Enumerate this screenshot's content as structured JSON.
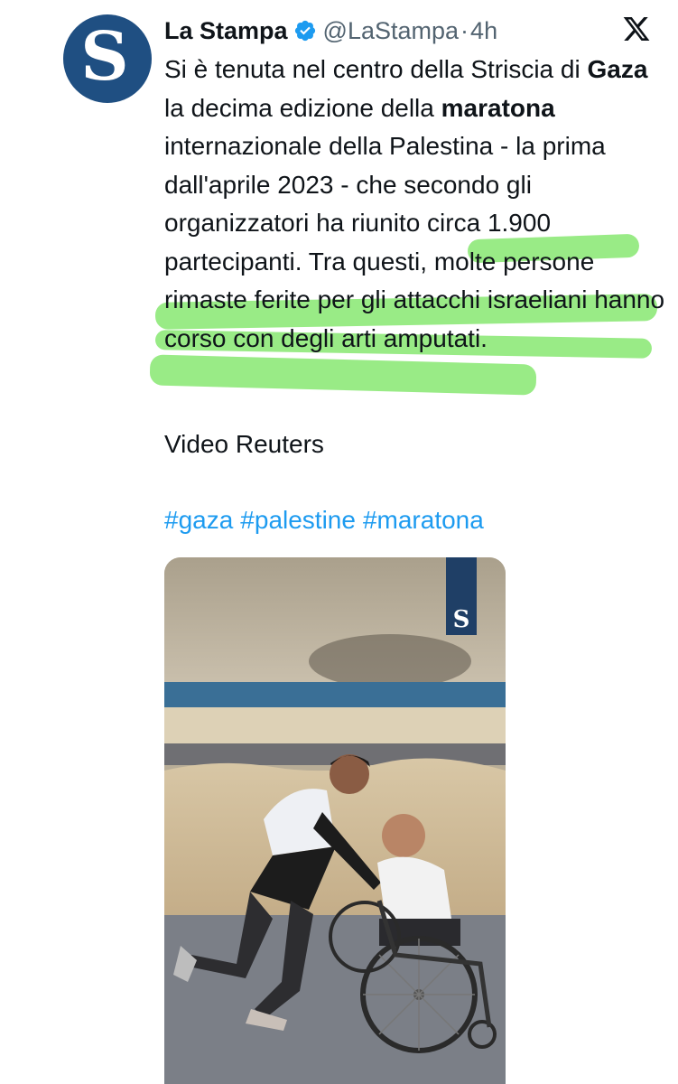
{
  "tweet": {
    "avatar_letter": "S",
    "author_name": "La Stampa",
    "verified": true,
    "handle": "@LaStampa",
    "separator": "·",
    "time": "4h",
    "text_segments": [
      "Si è tenuta nel centro della Striscia di ",
      "Gaza",
      " la decima edizione della ",
      "maratona",
      " internazionale della Palestina - la prima dall'aprile 2023 - che secondo gli organizzatori ha riunito circa 1.900 partecipanti. Tra questi, molte persone rimaste ferite per gli attacchi israeliani hanno corso con degli arti amputati."
    ],
    "credit": "Video Reuters",
    "hashtags": [
      "#gaza",
      "#palestine",
      "#maratona"
    ]
  },
  "video": {
    "watermark_letter": "S",
    "description": "runner pushing man in wheelchair on beach road"
  },
  "colors": {
    "brand_blue": "#1f4f82",
    "link": "#1d9bf0",
    "highlight": "#5ade3c",
    "muted": "#536471"
  },
  "icons": [
    "verified-badge-icon",
    "x-logo-icon"
  ]
}
